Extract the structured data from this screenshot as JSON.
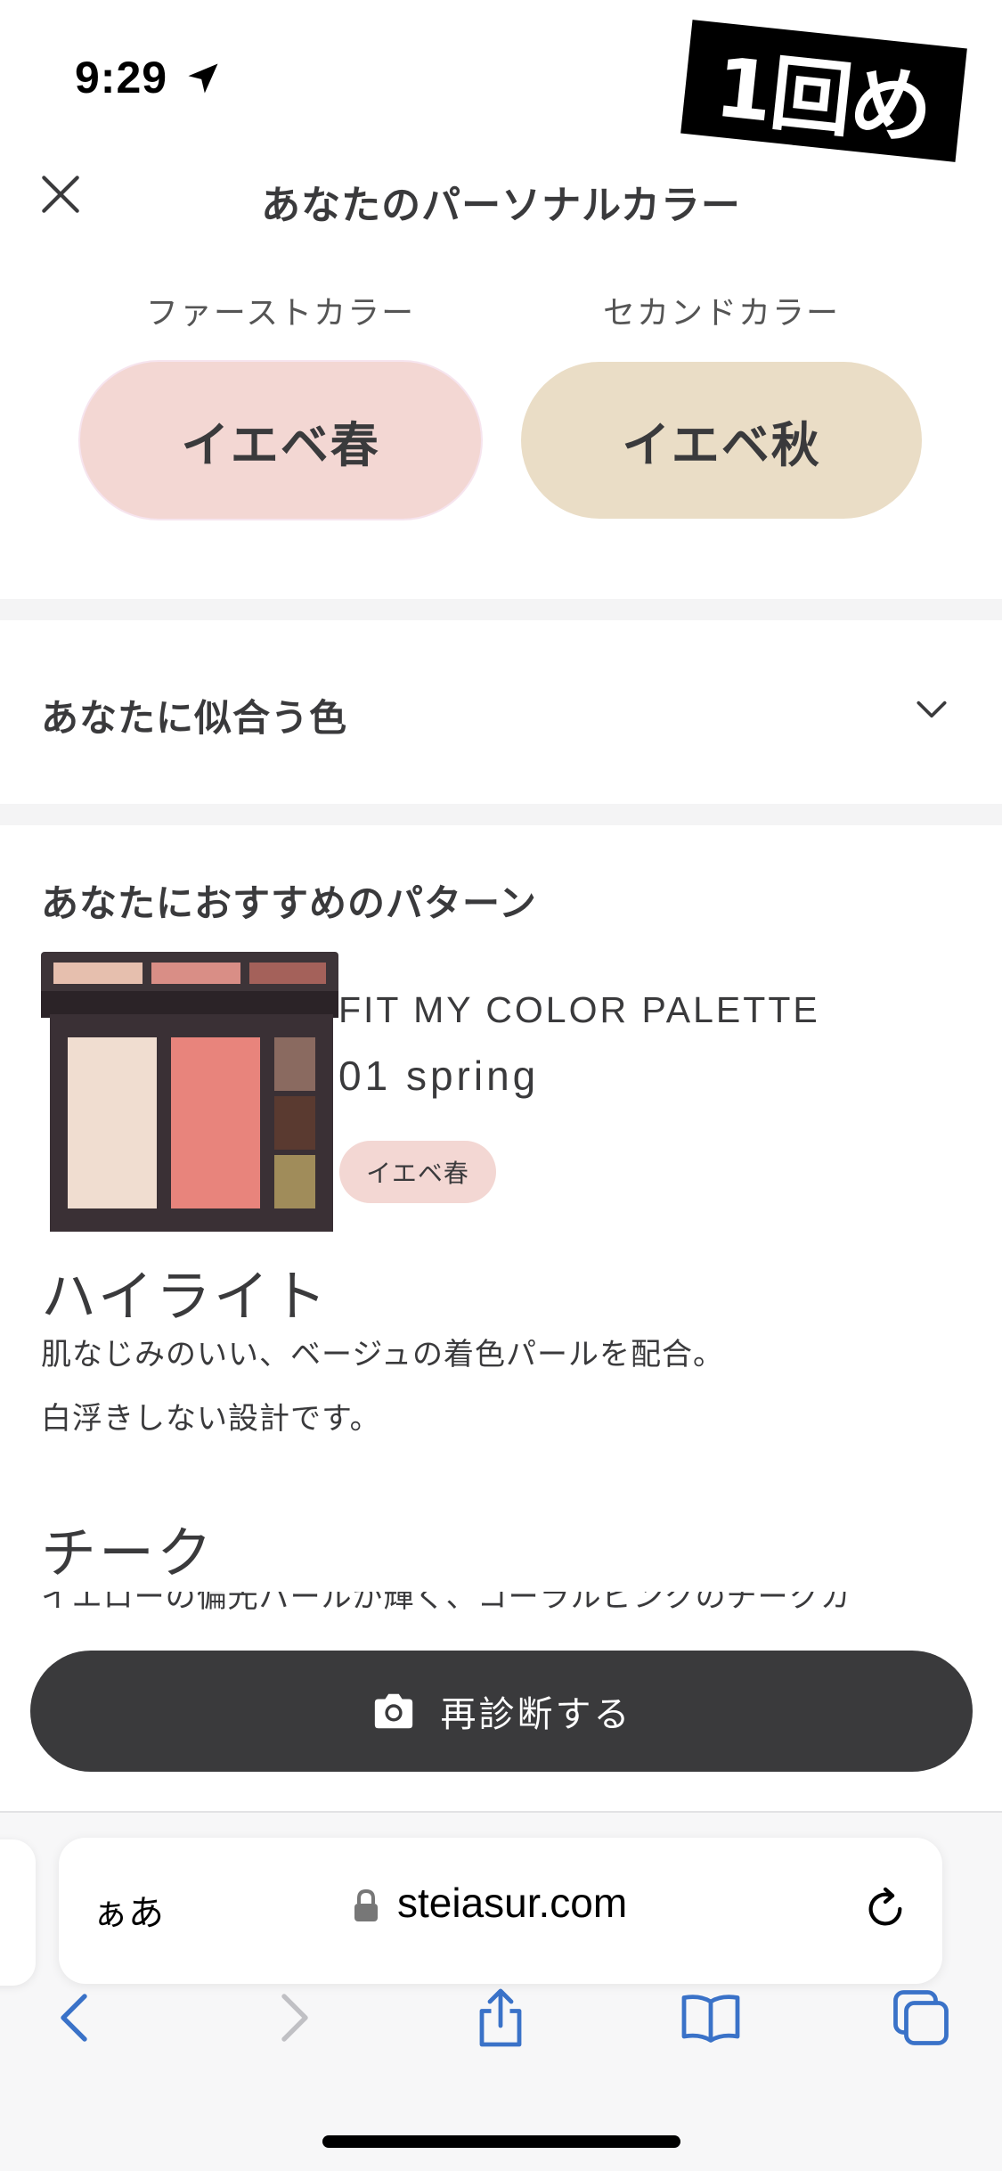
{
  "status_bar": {
    "time": "9:29"
  },
  "sticker": {
    "label": "1回め"
  },
  "header": {
    "title": "あなたのパーソナルカラー"
  },
  "colors": {
    "first_label": "ファーストカラー",
    "first_value": "イエベ春",
    "second_label": "セカンドカラー",
    "second_value": "イエベ秋",
    "first_pill_color": "#f3d7d3",
    "second_pill_color": "#eaddc6"
  },
  "accordion": {
    "title": "あなたに似合う色"
  },
  "recommend": {
    "title": "あなたにおすすめのパターン",
    "product_name": "FIT MY COLOR PALETTE",
    "product_variant": "01 spring",
    "tag": "イエベ春",
    "highlight_title": "ハイライト",
    "highlight_desc_1": "肌なじみのいい、ベージュの着色パールを配合。",
    "highlight_desc_2": "白浮きしない設計です。",
    "cheek_title": "チーク",
    "cheek_desc_partial": "イエローの偏光パールが輝く、コーラルピンクのチークカ"
  },
  "actions": {
    "rediagnose": "再診断する"
  },
  "browser": {
    "aa_label": "ぁあ",
    "url": "steiasur.com"
  },
  "icons": {
    "status": "location-arrow-icon",
    "close": "close-icon",
    "chevron": "chevron-down-icon",
    "camera": "camera-icon",
    "lock": "lock-icon",
    "reload": "reload-icon",
    "back": "back-icon",
    "forward": "forward-icon",
    "share": "share-icon",
    "bookmarks": "bookmarks-icon",
    "tabs": "tabs-icon"
  },
  "accent_color": "#3a72c8"
}
